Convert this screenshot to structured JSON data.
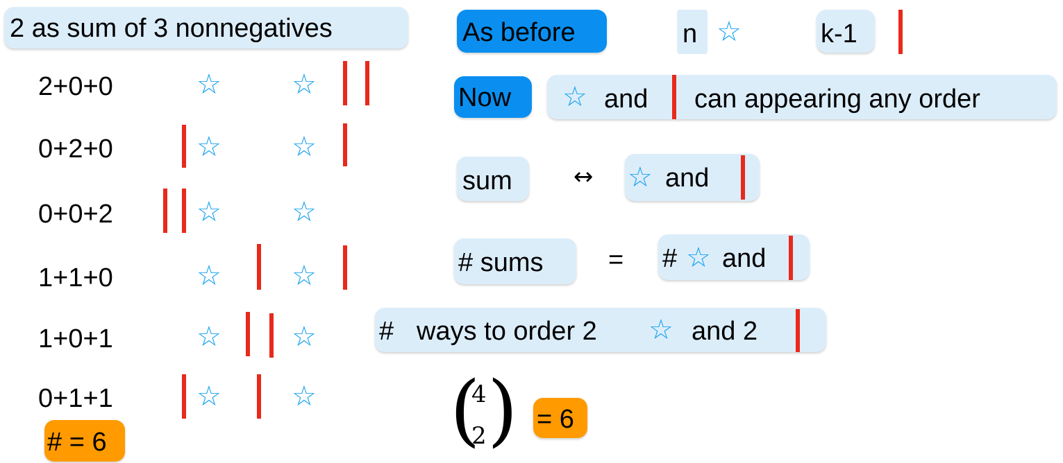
{
  "left": {
    "title": "2 as sum of 3 nonnegatives",
    "rows": [
      {
        "sum": "2+0+0"
      },
      {
        "sum": "0+2+0"
      },
      {
        "sum": "0+0+2"
      },
      {
        "sum": "1+1+0"
      },
      {
        "sum": "1+0+1"
      },
      {
        "sum": "0+1+1"
      }
    ],
    "count_label": "# = 6"
  },
  "right": {
    "as_before_label": "As before",
    "n_label": "n",
    "k_label": "k-1",
    "now_label": "Now",
    "now_rest_and": "and",
    "now_rest_text": "can appearing any order",
    "sum_label": "sum",
    "arrow": "↔",
    "sum_rhs_and": "and",
    "sums_label": "# sums",
    "equals": "=",
    "hash": "#",
    "sums_rhs_and": "and",
    "ways_hash": "#",
    "ways_text": "ways to order 2",
    "ways_and": "and 2",
    "binom_top": "4",
    "binom_bottom": "2",
    "binom_result": "= 6"
  },
  "colors": {
    "star": "#1aa3f0",
    "bar": "#e8291c",
    "highlight_light": "#dcedfa",
    "highlight_blue": "#0a8ff0",
    "highlight_orange": "#ff9a00"
  },
  "icons": {
    "star": "star-outline-icon",
    "bar": "red-bar"
  }
}
